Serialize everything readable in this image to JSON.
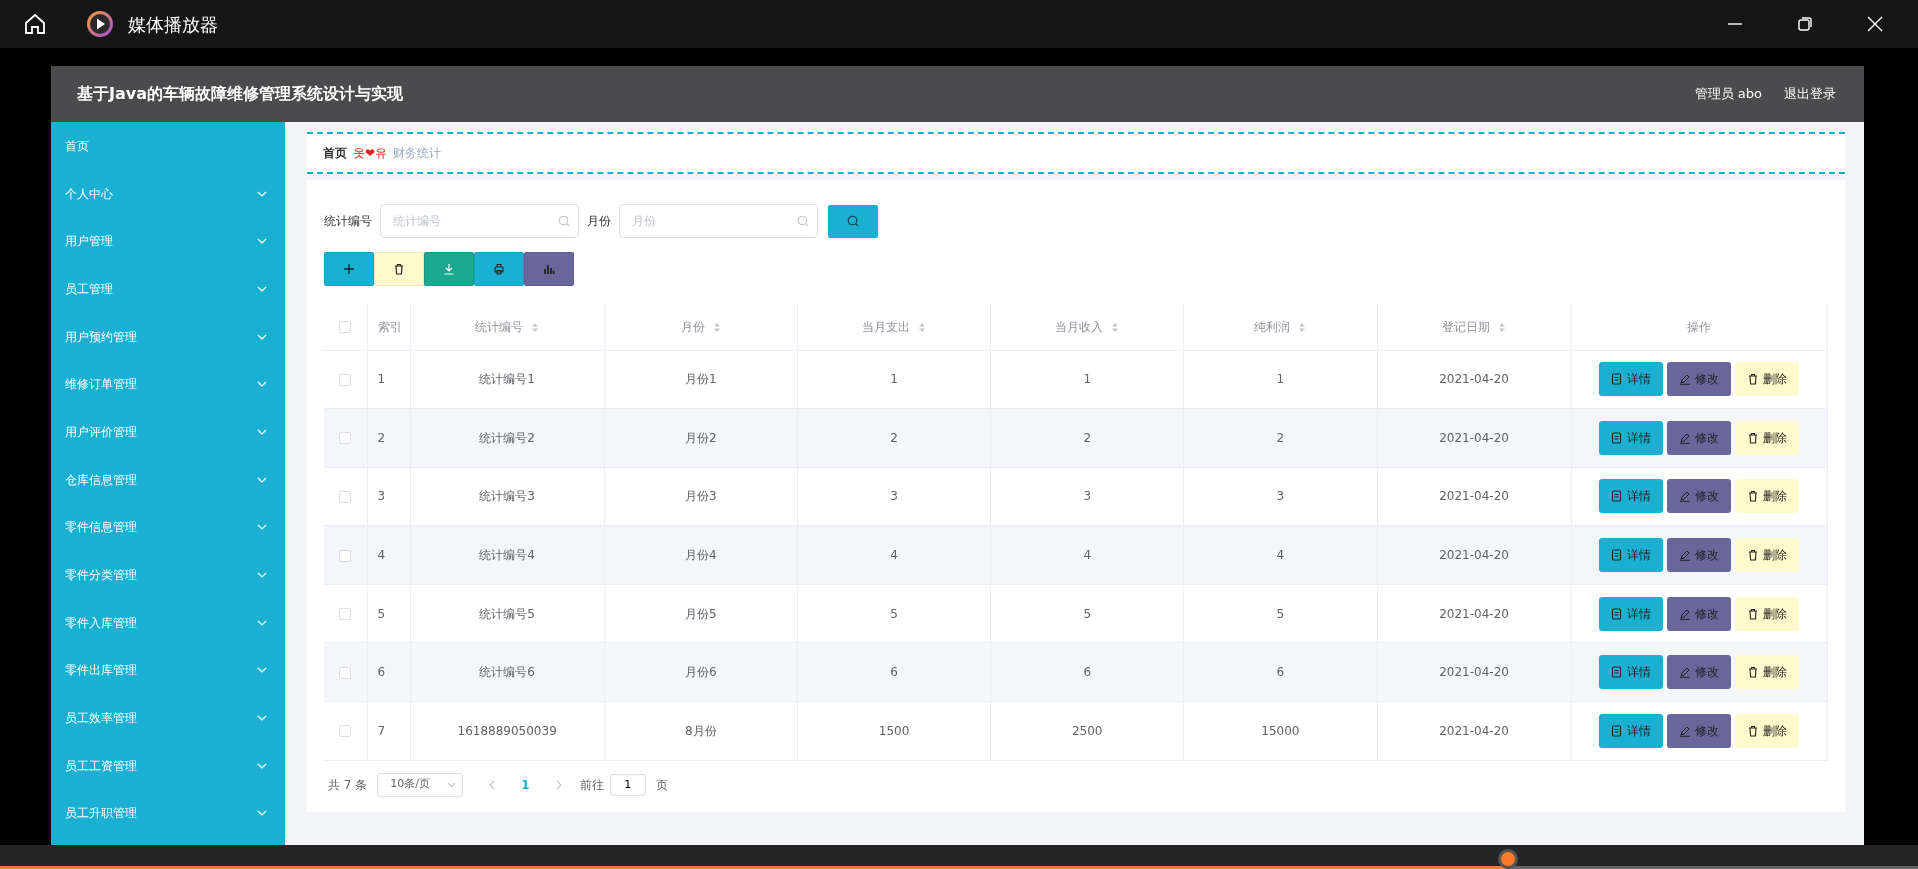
{
  "window": {
    "title": "媒体播放器"
  },
  "app": {
    "title": "基于Java的车辆故障维修管理系统设计与实现",
    "user": "管理员 abo",
    "logout": "退出登录"
  },
  "sidebar": {
    "items": [
      {
        "label": "首页",
        "expandable": false
      },
      {
        "label": "个人中心",
        "expandable": true
      },
      {
        "label": "用户管理",
        "expandable": true
      },
      {
        "label": "员工管理",
        "expandable": true
      },
      {
        "label": "用户预约管理",
        "expandable": true
      },
      {
        "label": "维修订单管理",
        "expandable": true
      },
      {
        "label": "用户评价管理",
        "expandable": true
      },
      {
        "label": "仓库信息管理",
        "expandable": true
      },
      {
        "label": "零件信息管理",
        "expandable": true
      },
      {
        "label": "零件分类管理",
        "expandable": true
      },
      {
        "label": "零件入库管理",
        "expandable": true
      },
      {
        "label": "零件出库管理",
        "expandable": true
      },
      {
        "label": "员工效率管理",
        "expandable": true
      },
      {
        "label": "员工工资管理",
        "expandable": true
      },
      {
        "label": "员工升职管理",
        "expandable": true
      }
    ]
  },
  "breadcrumb": [
    {
      "label": "首页",
      "kind": "link"
    },
    {
      "label": "옷❤유",
      "kind": "separator"
    },
    {
      "label": "财务统计",
      "kind": "current"
    }
  ],
  "search": {
    "fields": [
      {
        "label": "统计编号",
        "placeholder": "统计编号"
      },
      {
        "label": "月份",
        "placeholder": "月份"
      }
    ]
  },
  "toolbar": [
    {
      "kind": "add"
    },
    {
      "kind": "delete"
    },
    {
      "kind": "export"
    },
    {
      "kind": "print"
    },
    {
      "kind": "chart"
    }
  ],
  "table": {
    "select_all": {
      "checked": false
    },
    "columns": [
      {
        "label": "索引",
        "sortable": false
      },
      {
        "label": "统计编号",
        "sortable": true
      },
      {
        "label": "月份",
        "sortable": true
      },
      {
        "label": "当月支出",
        "sortable": true
      },
      {
        "label": "当月收入",
        "sortable": true
      },
      {
        "label": "纯利润",
        "sortable": true
      },
      {
        "label": "登记日期",
        "sortable": true
      },
      {
        "label": "操作",
        "sortable": false
      }
    ],
    "rows": [
      {
        "checked": false,
        "cells": [
          "1",
          "统计编号1",
          "月份1",
          "1",
          "1",
          "1",
          "2021-04-20"
        ],
        "actions": [
          "详情",
          "修改",
          "删除"
        ]
      },
      {
        "checked": false,
        "cells": [
          "2",
          "统计编号2",
          "月份2",
          "2",
          "2",
          "2",
          "2021-04-20"
        ],
        "actions": [
          "详情",
          "修改",
          "删除"
        ]
      },
      {
        "checked": false,
        "cells": [
          "3",
          "统计编号3",
          "月份3",
          "3",
          "3",
          "3",
          "2021-04-20"
        ],
        "actions": [
          "详情",
          "修改",
          "删除"
        ]
      },
      {
        "checked": false,
        "cells": [
          "4",
          "统计编号4",
          "月份4",
          "4",
          "4",
          "4",
          "2021-04-20"
        ],
        "actions": [
          "详情",
          "修改",
          "删除"
        ]
      },
      {
        "checked": false,
        "cells": [
          "5",
          "统计编号5",
          "月份5",
          "5",
          "5",
          "5",
          "2021-04-20"
        ],
        "actions": [
          "详情",
          "修改",
          "删除"
        ]
      },
      {
        "checked": false,
        "cells": [
          "6",
          "统计编号6",
          "月份6",
          "6",
          "6",
          "6",
          "2021-04-20"
        ],
        "actions": [
          "详情",
          "修改",
          "删除"
        ]
      },
      {
        "checked": false,
        "cells": [
          "7",
          "1618889050039",
          "8月份",
          "1500",
          "2500",
          "15000",
          "2021-04-20"
        ],
        "actions": [
          "详情",
          "修改",
          "删除"
        ]
      }
    ]
  },
  "pagination": {
    "total": "共 7 条",
    "page_size": "10条/页",
    "pages": [
      {
        "label": "1",
        "selected": true
      }
    ],
    "goto_label": "前往",
    "goto_value": "1",
    "goto_suffix": "页"
  },
  "player": {
    "progress": {
      "level": 0.786
    }
  }
}
